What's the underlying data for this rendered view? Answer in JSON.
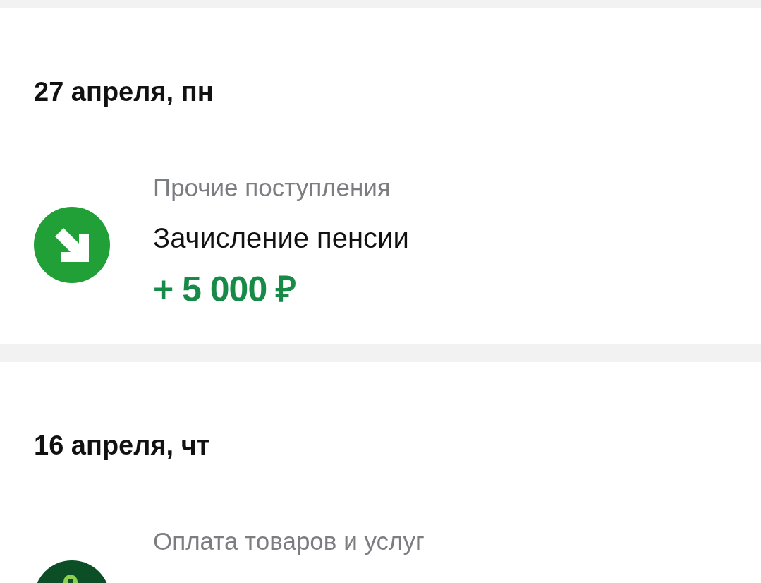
{
  "days": [
    {
      "date": "27 апреля, пн",
      "operations": [
        {
          "kind": "income",
          "category": "Прочие поступления",
          "title": "Зачисление пенсии",
          "amount": "+ 5 000 ₽"
        }
      ]
    },
    {
      "date": "16 апреля, чт",
      "operations": [
        {
          "kind": "payment",
          "category": "Оплата товаров и услуг"
        }
      ]
    }
  ]
}
